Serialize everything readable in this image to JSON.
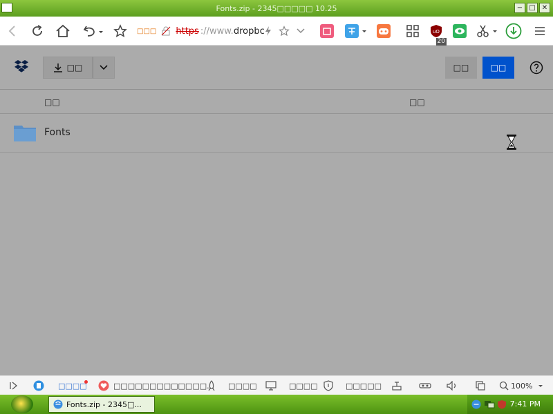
{
  "window": {
    "title": "Fonts.zip - 2345□□□□□ 10.25",
    "buttons": [
      "−",
      "□",
      "✕"
    ]
  },
  "toolbar": {
    "secure_badge": "□□□",
    "url_scheme": "https",
    "url_separator": "://www.",
    "url_host": "dropbc",
    "extension_badge": "20"
  },
  "page": {
    "download_label": "□□",
    "signin_label": "□□",
    "signup_label": "□□",
    "column_name": "□□",
    "column_modified": "□□",
    "rows": [
      {
        "name": "Fonts",
        "type": "folder"
      }
    ]
  },
  "statusbar": {
    "item1": "□□□□",
    "item2": "□□□□□□□□□□□□□...",
    "item3": "□□□□",
    "item4": "□□□□",
    "item5": "□□□□□",
    "zoom": "100%"
  },
  "taskbar": {
    "task_label": "Fonts.zip - 2345□...",
    "clock": "7:41 PM"
  },
  "colors": {
    "titlebar_green": "#6fb02a",
    "dropbox_blue": "#0052cc",
    "page_overlay": "#ababab"
  },
  "icons": [
    "back-icon",
    "reload-icon",
    "home-icon",
    "undo-icon",
    "star-icon",
    "lightning-icon",
    "chevron-down-icon",
    "shop-icon",
    "translate-icon",
    "game-icon",
    "grid-icon",
    "ublock-icon",
    "eye-icon",
    "scissors-icon",
    "download-icon",
    "menu-icon",
    "dropbox-logo-icon",
    "folder-icon",
    "help-icon",
    "hourglass-icon"
  ]
}
